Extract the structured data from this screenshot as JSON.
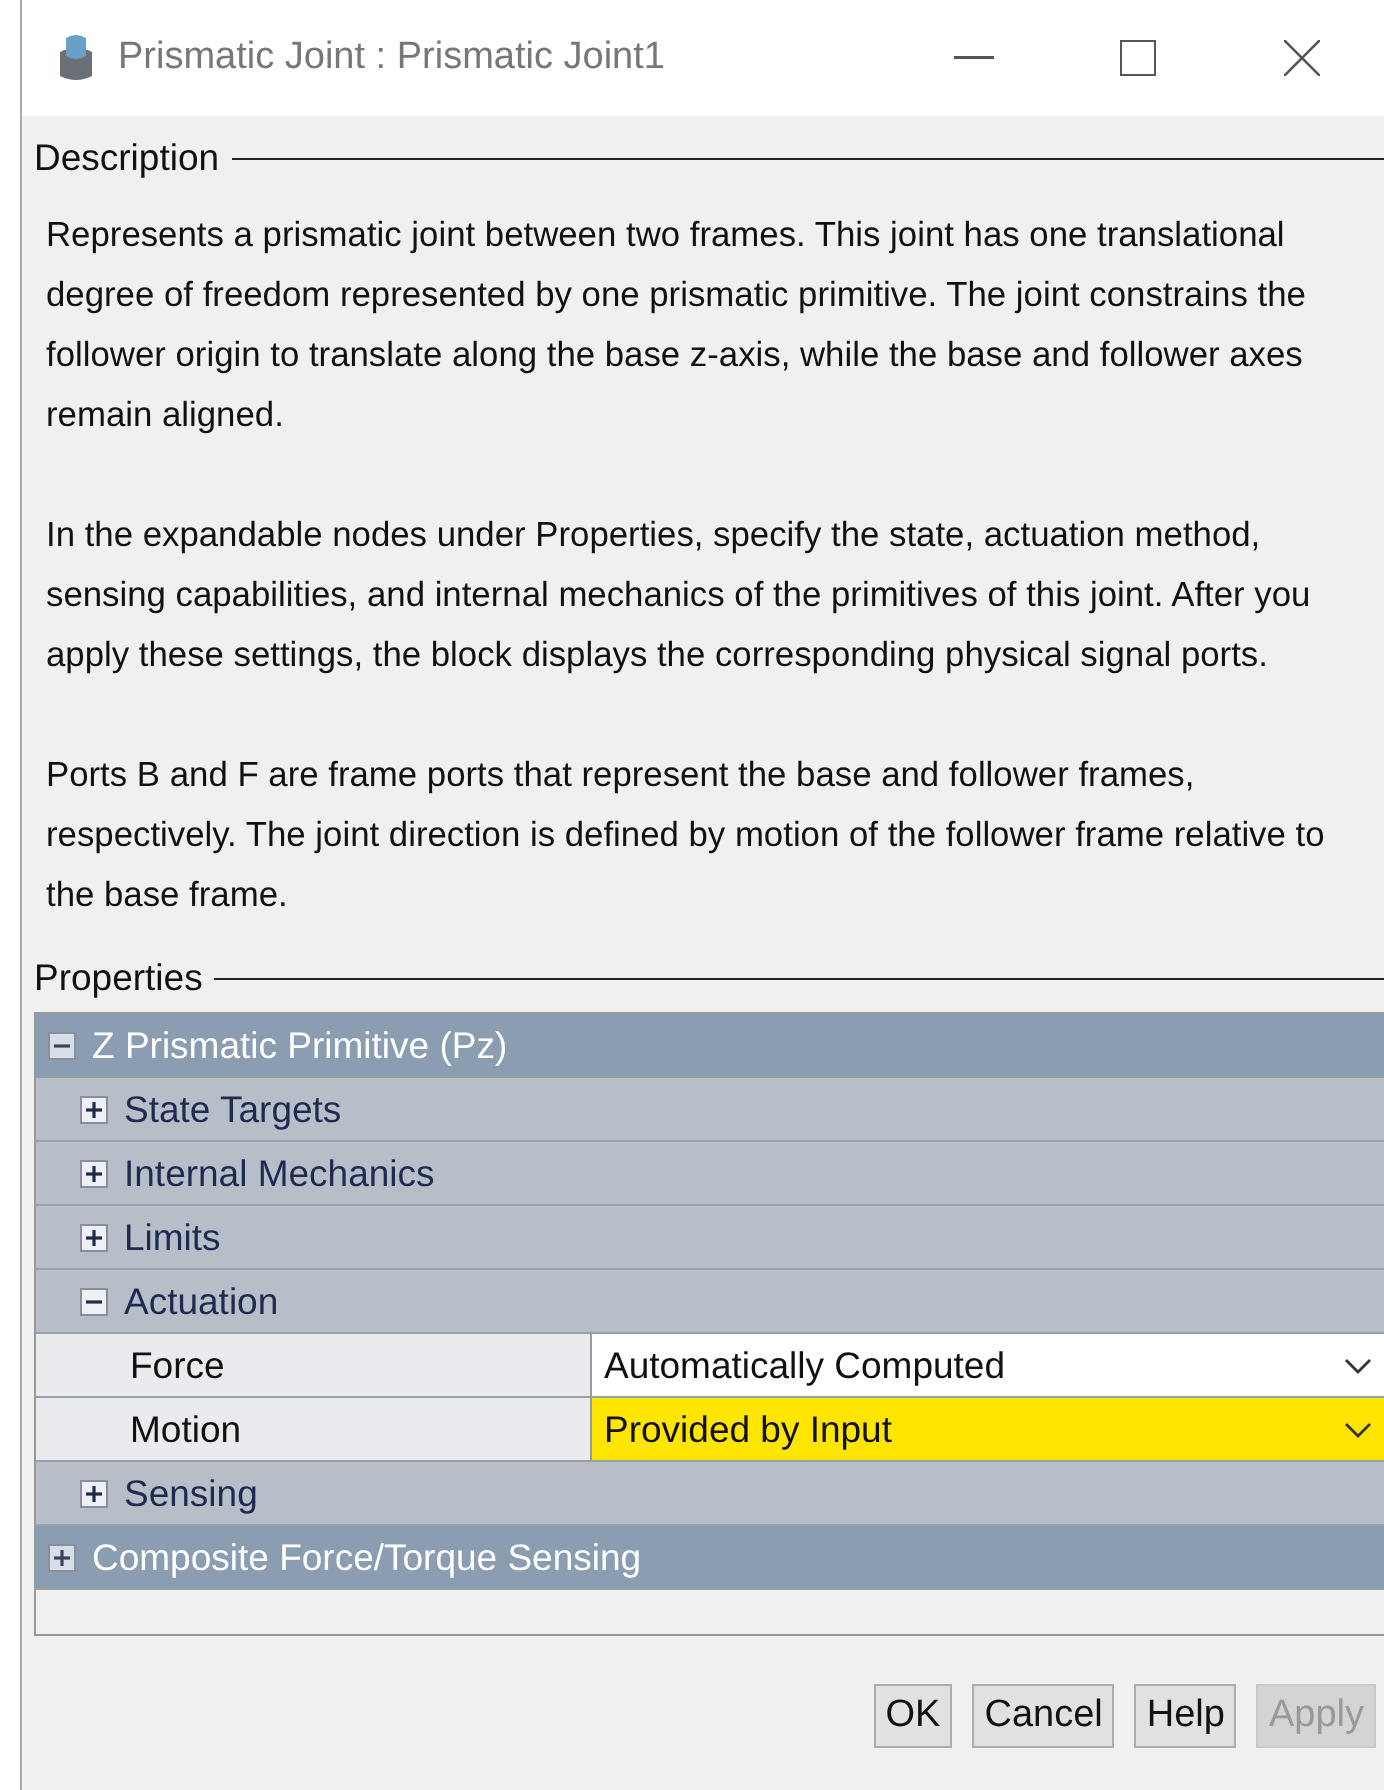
{
  "window": {
    "title": "Prismatic Joint : Prismatic Joint1"
  },
  "description": {
    "label": "Description",
    "paragraphs": [
      "Represents a prismatic joint between two frames. This joint has one translational degree of freedom represented by one prismatic primitive. The joint constrains the follower origin to translate along the base z-axis, while the base and follower axes remain aligned.",
      "In the expandable nodes under Properties, specify the state, actuation method, sensing capabilities, and internal mechanics of the primitives of this joint. After you apply these settings, the block displays the corresponding physical signal ports.",
      "Ports B and F are frame ports that represent the base and follower frames, respectively. The joint direction is defined by motion of the follower frame relative to the base frame."
    ]
  },
  "properties": {
    "label": "Properties",
    "tree": [
      {
        "kind": "group",
        "label": "Z Prismatic Primitive (Pz)",
        "expanded": true,
        "children": [
          {
            "kind": "group",
            "label": "State Targets",
            "expanded": false
          },
          {
            "kind": "group",
            "label": "Internal Mechanics",
            "expanded": false
          },
          {
            "kind": "group",
            "label": "Limits",
            "expanded": false
          },
          {
            "kind": "group",
            "label": "Actuation",
            "expanded": true,
            "children": [
              {
                "kind": "param",
                "label": "Force",
                "value": "Automatically Computed",
                "highlighted": false
              },
              {
                "kind": "param",
                "label": "Motion",
                "value": "Provided by Input",
                "highlighted": true
              }
            ]
          },
          {
            "kind": "group",
            "label": "Sensing",
            "expanded": false
          }
        ]
      },
      {
        "kind": "group",
        "label": "Composite Force/Torque Sensing",
        "expanded": false
      }
    ]
  },
  "buttons": [
    {
      "label": "OK",
      "disabled": false
    },
    {
      "label": "Cancel",
      "disabled": false
    },
    {
      "label": "Help",
      "disabled": false
    },
    {
      "label": "Apply",
      "disabled": true
    }
  ]
}
